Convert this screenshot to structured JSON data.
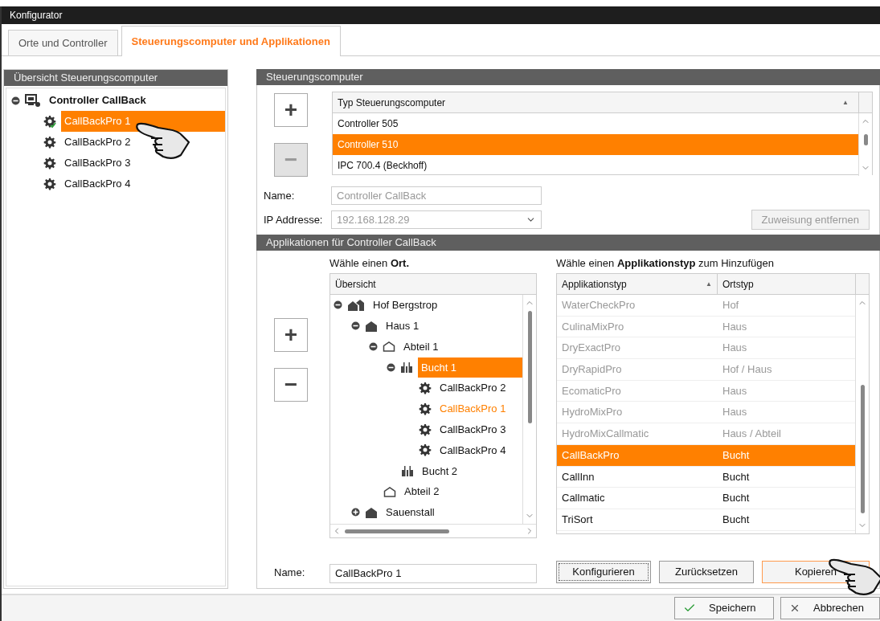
{
  "window": {
    "title": "Konfigurator"
  },
  "tabs": [
    {
      "label": "Orte und Controller",
      "selected": false
    },
    {
      "label": "Steuerungscomputer und Applikationen",
      "selected": true
    }
  ],
  "overview": {
    "title": "Übersicht Steuerungscomputer",
    "tree": [
      {
        "label": "Controller CallBack",
        "kind": "controller",
        "expanded": true,
        "selected": false,
        "children": [
          {
            "label": "CallBackPro 1",
            "kind": "app-ok",
            "selected": true
          },
          {
            "label": "CallBackPro 2",
            "kind": "app",
            "selected": false
          },
          {
            "label": "CallBackPro 3",
            "kind": "app",
            "selected": false
          },
          {
            "label": "CallBackPro 4",
            "kind": "app",
            "selected": false
          }
        ]
      }
    ]
  },
  "computer": {
    "title": "Steuerungscomputer",
    "add_button": "+",
    "remove_button": "−",
    "remove_disabled": true,
    "column": "Typ Steuerungscomputer",
    "sort_mark": "▲",
    "rows": [
      {
        "label": "Controller 505",
        "selected": false
      },
      {
        "label": "Controller 510",
        "selected": true
      },
      {
        "label": "IPC 700.4 (Beckhoff)",
        "selected": false
      }
    ],
    "name_label": "Name:",
    "name_value": "Controller CallBack",
    "ip_label": "IP Addresse:",
    "ip_value": "192.168.128.29",
    "unassign_button": "Zuweisung entfernen",
    "unassign_disabled": true
  },
  "applications": {
    "title": "Applikationen für Controller CallBack",
    "add_button": "+",
    "remove_button": "−",
    "place_prompt": "Wähle einen **Ort.**",
    "place_column": "Übersicht",
    "places": [
      {
        "label": "Hof Bergstrop",
        "kind": "farm",
        "expanded": true,
        "selected": false,
        "current": false,
        "children": [
          {
            "label": "Haus 1",
            "kind": "house",
            "expanded": true,
            "selected": false,
            "current": false,
            "children": [
              {
                "label": "Abteil 1",
                "kind": "section",
                "expanded": true,
                "selected": false,
                "current": false,
                "children": [
                  {
                    "label": "Bucht 1",
                    "kind": "pen",
                    "expanded": true,
                    "selected": true,
                    "current": false,
                    "children": [
                      {
                        "label": "CallBackPro 2",
                        "kind": "app",
                        "selected": false,
                        "current": false
                      },
                      {
                        "label": "CallBackPro 1",
                        "kind": "app",
                        "selected": false,
                        "current": true
                      },
                      {
                        "label": "CallBackPro 3",
                        "kind": "app",
                        "selected": false,
                        "current": false
                      },
                      {
                        "label": "CallBackPro 4",
                        "kind": "app",
                        "selected": false,
                        "current": false
                      }
                    ]
                  },
                  {
                    "label": "Bucht 2",
                    "kind": "pen",
                    "selected": false,
                    "current": false
                  }
                ]
              },
              {
                "label": "Abteil 2",
                "kind": "section",
                "selected": false,
                "current": false
              }
            ]
          },
          {
            "label": "Sauenstall",
            "kind": "house",
            "expanded": false,
            "selected": false,
            "current": false
          }
        ]
      }
    ],
    "type_prompt": "Wähle einen **Applikationstyp** zum Hinzufügen",
    "type_columns": [
      "Applikationstyp",
      "Ortstyp"
    ],
    "sort_mark": "▲",
    "types": [
      {
        "name": "WaterCheckPro",
        "place": "Hof",
        "disabled": true,
        "selected": false
      },
      {
        "name": "CulinaMixPro",
        "place": "Haus",
        "disabled": true,
        "selected": false
      },
      {
        "name": "DryExactPro",
        "place": "Haus",
        "disabled": true,
        "selected": false
      },
      {
        "name": "DryRapidPro",
        "place": "Hof / Haus",
        "disabled": true,
        "selected": false
      },
      {
        "name": "EcomaticPro",
        "place": "Haus",
        "disabled": true,
        "selected": false
      },
      {
        "name": "HydroMixPro",
        "place": "Haus",
        "disabled": true,
        "selected": false
      },
      {
        "name": "HydroMixCallmatic",
        "place": "Haus / Abteil",
        "disabled": true,
        "selected": false
      },
      {
        "name": "CallBackPro",
        "place": "Bucht",
        "disabled": false,
        "selected": true
      },
      {
        "name": "CallInn",
        "place": "Bucht",
        "disabled": false,
        "selected": false
      },
      {
        "name": "Callmatic",
        "place": "Bucht",
        "disabled": false,
        "selected": false
      },
      {
        "name": "TriSort",
        "place": "Bucht",
        "disabled": false,
        "selected": false
      }
    ],
    "name_label": "Name:",
    "name_value": "CallBackPro 1",
    "buttons": [
      {
        "label": "Konfigurieren",
        "focused": true,
        "highlighted": false
      },
      {
        "label": "Zurücksetzen",
        "focused": false,
        "highlighted": false
      },
      {
        "label": "Kopieren",
        "focused": false,
        "highlighted": true
      }
    ]
  },
  "footer": {
    "buttons": [
      {
        "label": "Speichern",
        "kind": "save"
      },
      {
        "label": "Abbrechen",
        "kind": "cancel"
      }
    ]
  }
}
